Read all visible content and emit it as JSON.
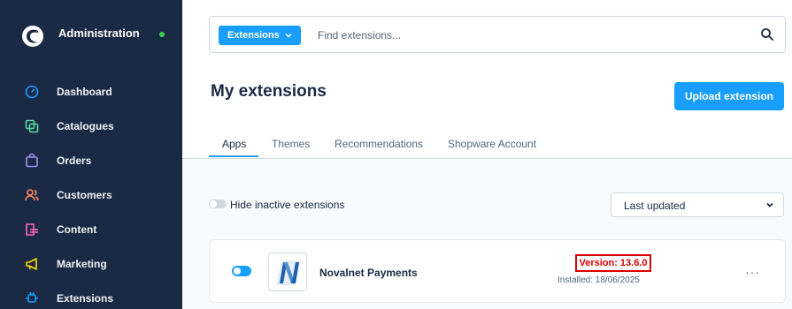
{
  "sidebar": {
    "title": "Administration",
    "items": [
      {
        "label": "Dashboard",
        "icon": "dashboard-gauge-icon",
        "color": "#189eff"
      },
      {
        "label": "Catalogues",
        "icon": "catalogue-icon",
        "color": "#57d9a3"
      },
      {
        "label": "Orders",
        "icon": "bag-icon",
        "color": "#a092f0"
      },
      {
        "label": "Customers",
        "icon": "customers-icon",
        "color": "#f88962"
      },
      {
        "label": "Content",
        "icon": "content-icon",
        "color": "#ff68b4"
      },
      {
        "label": "Marketing",
        "icon": "megaphone-icon",
        "color": "#ffd700"
      },
      {
        "label": "Extensions",
        "icon": "extension-plug-icon",
        "color": "#189eff"
      }
    ]
  },
  "search": {
    "scope_label": "Extensions",
    "placeholder": "Find extensions..."
  },
  "page": {
    "title": "My extensions",
    "upload_label": "Upload extension"
  },
  "tabs": [
    {
      "label": "Apps",
      "active": true
    },
    {
      "label": "Themes",
      "active": false
    },
    {
      "label": "Recommendations",
      "active": false
    },
    {
      "label": "Shopware Account",
      "active": false
    }
  ],
  "filters": {
    "hide_inactive_label": "Hide inactive extensions",
    "sort_value": "Last updated"
  },
  "extension": {
    "name": "Novalnet Payments",
    "version": "Version: 13.6.0",
    "installed": "Installed: 18/06/2025",
    "active": true
  },
  "colors": {
    "accent": "#189eff",
    "sidebar_bg": "#1b2a44",
    "highlight": "#e00000"
  }
}
